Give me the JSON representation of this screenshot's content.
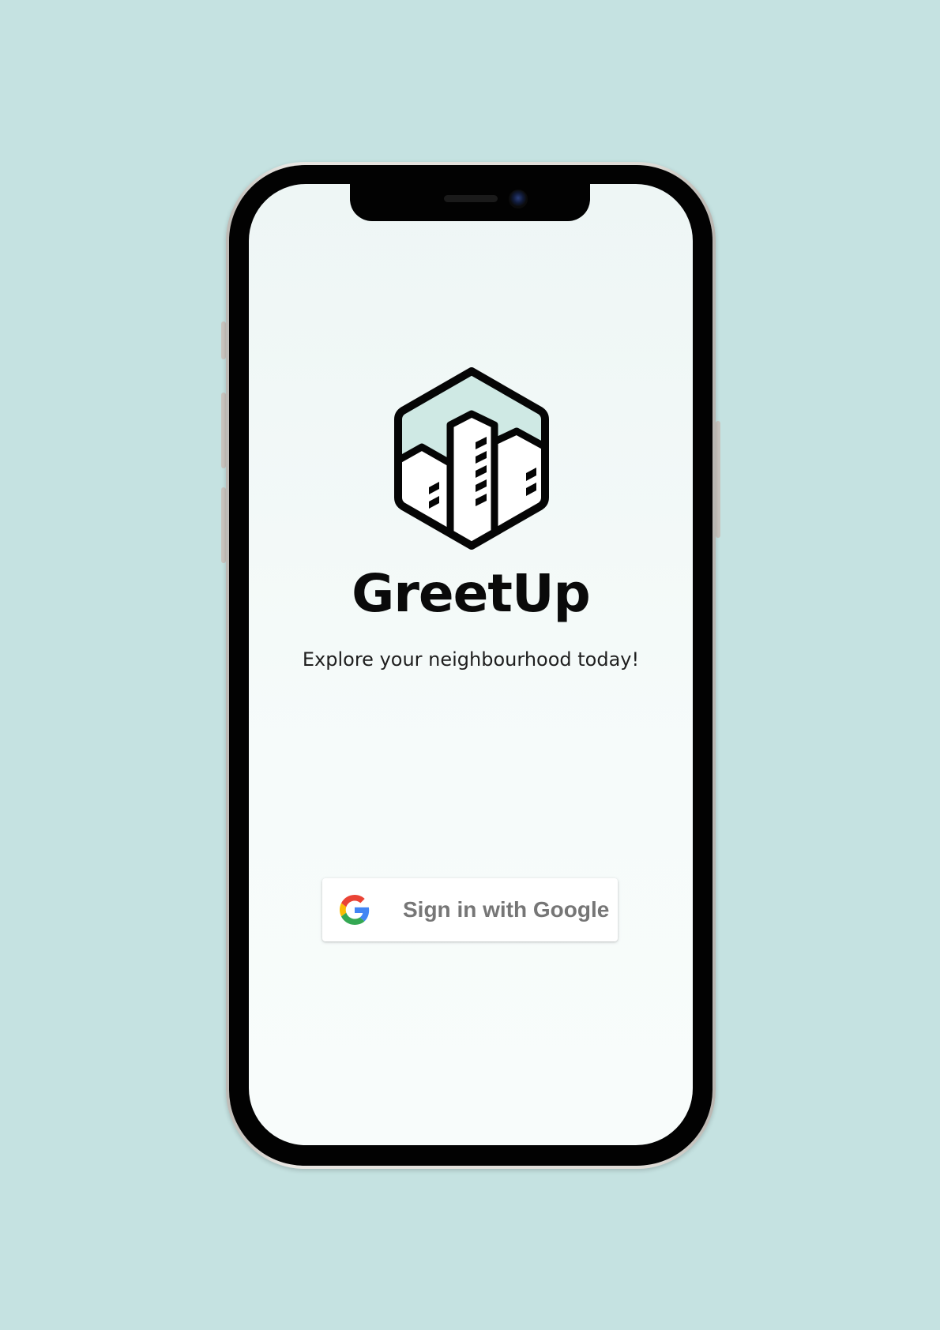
{
  "app": {
    "name": "GreetUp",
    "tagline": "Explore your neighbourhood today!"
  },
  "logo": {
    "icon": "city-buildings-hexagon-icon",
    "sky_color": "#cfe9e4"
  },
  "auth": {
    "google_button_label": "Sign in with Google",
    "google_icon": "google-g-icon"
  },
  "colors": {
    "background": "#c5e2e1",
    "screen": "#f3f9f8",
    "text": "#0a0a0a",
    "button_text": "#767676"
  }
}
